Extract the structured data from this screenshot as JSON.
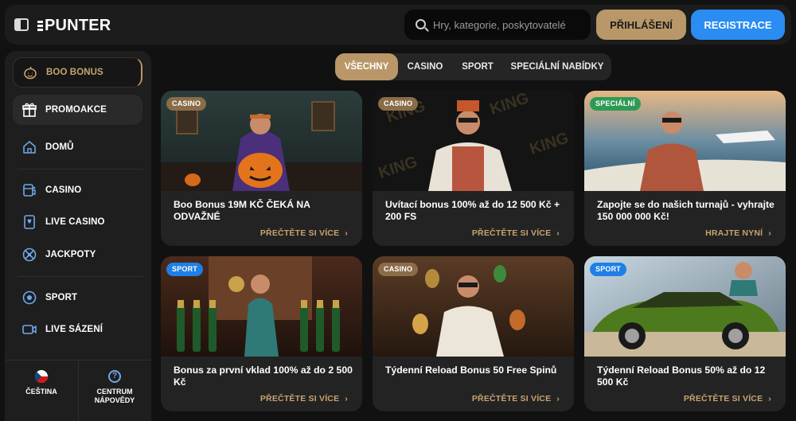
{
  "header": {
    "logo_text": "PUNTER",
    "search_placeholder": "Hry, kategorie, poskytovatelé",
    "login_label": "PŘIHLÁŠENÍ",
    "register_label": "REGISTRACE"
  },
  "sidebar": {
    "items": [
      {
        "label": "BOO BONUS",
        "icon": "pumpkin-icon"
      },
      {
        "label": "PROMOAKCE",
        "icon": "gift-icon"
      },
      {
        "label": "DOMŮ",
        "icon": "home-icon"
      },
      {
        "label": "CASINO",
        "icon": "casino-icon"
      },
      {
        "label": "LIVE CASINO",
        "icon": "card-icon"
      },
      {
        "label": "JACKPOTY",
        "icon": "jackpot-icon"
      },
      {
        "label": "SPORT",
        "icon": "soccer-ball-icon"
      },
      {
        "label": "LIVE SÁZENÍ",
        "icon": "video-icon"
      }
    ],
    "language_label": "ČEŠTINA",
    "help_label": "CENTRUM NÁPOVĚDY"
  },
  "filters": {
    "tabs": [
      "VŠECHNY",
      "CASINO",
      "SPORT",
      "SPECIÁLNÍ NABÍDKY"
    ],
    "active": "VŠECHNY"
  },
  "cards": [
    {
      "badge": "CASINO",
      "title": "Boo Bonus 19M KČ ČEKÁ NA ODVAŽNÉ",
      "cta": "PŘEČTĚTE SI VÍCE"
    },
    {
      "badge": "CASINO",
      "title": "Uvítací bonus 100% až do 12 500 Kč + 200 FS",
      "cta": "PŘEČTĚTE SI VÍCE"
    },
    {
      "badge": "SPECIÁLNÍ",
      "title": "Zapojte se do našich turnajů - vyhrajte 150 000 000 Kč!",
      "cta": "HRAJTE NYNÍ"
    },
    {
      "badge": "SPORT",
      "title": "Bonus za první vklad 100% až do 2 500 Kč",
      "cta": "PŘEČTĚTE SI VÍCE"
    },
    {
      "badge": "CASINO",
      "title": "Týdenní Reload Bonus 50 Free Spinů",
      "cta": "PŘEČTĚTE SI VÍCE"
    },
    {
      "badge": "SPORT",
      "title": "Týdenní Reload Bonus 50% až do 12 500 Kč",
      "cta": "PŘEČTĚTE SI VÍCE"
    }
  ],
  "colors": {
    "accent_gold": "#b99768",
    "accent_blue": "#2b8cf2",
    "background": "#111111",
    "panel": "#1e1e1e"
  }
}
